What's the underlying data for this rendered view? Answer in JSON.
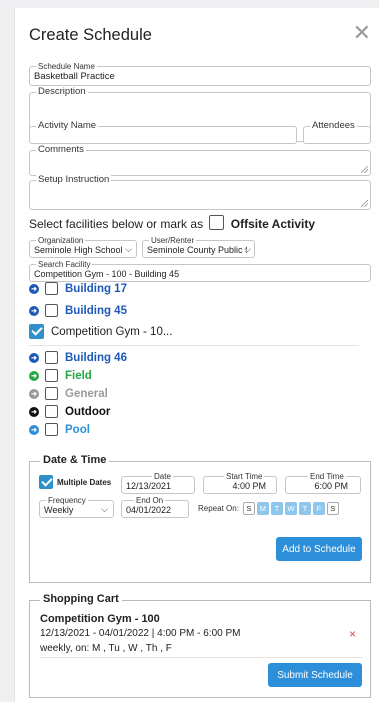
{
  "dialog": {
    "title": "Create Schedule"
  },
  "fields": {
    "schedule_name": {
      "label": "Schedule Name",
      "value": "Basketball Practice"
    },
    "description": {
      "label": "Description",
      "value": ""
    },
    "activity_name": {
      "label": "Activity Name",
      "value": ""
    },
    "attendees": {
      "label": "Attendees",
      "value": ""
    },
    "comments": {
      "label": "Comments",
      "value": ""
    },
    "setup_instruction": {
      "label": "Setup Instruction",
      "value": ""
    }
  },
  "offsite": {
    "prefix": "Select facilities below or mark as",
    "label": "Offsite Activity",
    "checked": false
  },
  "filters": {
    "organization": {
      "label": "Organization",
      "value": "Seminole High School"
    },
    "user": {
      "label": "User/Renter",
      "value": "Seminole County Public Sc"
    },
    "search_facility": {
      "label": "Search Facility",
      "value": "Competition Gym - 100 - Building 45"
    }
  },
  "facilities_top": [
    {
      "label": "Building 17",
      "color": "#1f59b8",
      "arrow_color": "#1f59b8",
      "checked": false,
      "bold": true
    },
    {
      "label": "Building 45",
      "color": "#1f59b8",
      "arrow_color": "#1f59b8",
      "checked": false,
      "bold": true
    },
    {
      "label": "Competition Gym - 10...",
      "color": "#222222",
      "checked": true,
      "bold": false
    }
  ],
  "facilities_list": [
    {
      "label": "Building 46",
      "color": "#1f59b8",
      "arrow_color": "#1f59b8"
    },
    {
      "label": "Field",
      "color": "#27a844",
      "arrow_color": "#27a844"
    },
    {
      "label": "General",
      "color": "#999999",
      "arrow_color": "#999999"
    },
    {
      "label": "Outdoor",
      "color": "#111111",
      "arrow_color": "#111111"
    },
    {
      "label": "Pool",
      "color": "#2d8fd9",
      "arrow_color": "#2d8fd9"
    }
  ],
  "date_time": {
    "title": "Date & Time",
    "multiple_dates": {
      "label": "Multiple Dates",
      "checked": true
    },
    "date": {
      "label": "Date",
      "value": "12/13/2021"
    },
    "start_time": {
      "label": "Start Time",
      "value": "4:00 PM"
    },
    "end_time": {
      "label": "End Time",
      "value": "6:00 PM"
    },
    "frequency": {
      "label": "Frequency",
      "value": "Weekly"
    },
    "end_on": {
      "label": "End On",
      "value": "04/01/2022"
    },
    "repeat_on_label": "Repeat On:",
    "days": [
      {
        "label": "S",
        "on": false
      },
      {
        "label": "M",
        "on": true
      },
      {
        "label": "T",
        "on": true
      },
      {
        "label": "W",
        "on": true
      },
      {
        "label": "T",
        "on": true
      },
      {
        "label": "F",
        "on": true
      },
      {
        "label": "S",
        "on": false
      }
    ],
    "add_button": "Add to Schedule"
  },
  "cart": {
    "title": "Shopping Cart",
    "item_name": "Competition Gym - 100",
    "item_dates": "12/13/2021 - 04/01/2022 | 4:00 PM - 6:00 PM",
    "item_repeat": "weekly, on: M , Tu , W , Th , F",
    "remove_icon": "×",
    "submit_button": "Submit Schedule"
  },
  "colors": {
    "accent": "#2d8fd9",
    "remove": "#e0474c"
  }
}
